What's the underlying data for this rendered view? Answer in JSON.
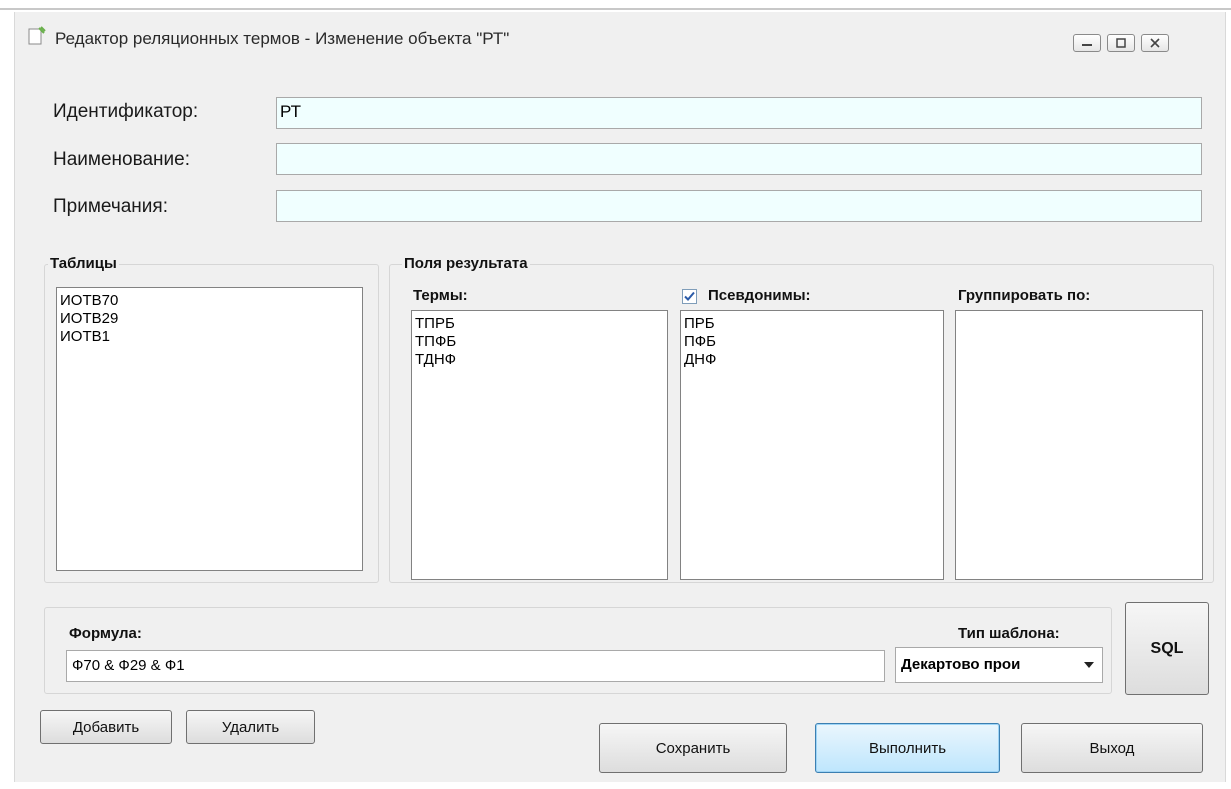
{
  "window": {
    "title": "Редактор реляционных термов  -  Изменение объекта \"РТ\""
  },
  "fields": {
    "identifier_label": "Идентификатор:",
    "identifier_value": "РТ",
    "name_label": "Наименование:",
    "name_value": "",
    "notes_label": "Примечания:",
    "notes_value": ""
  },
  "tables_group": {
    "label": "Таблицы",
    "items": [
      "ИОТВ70",
      "ИОТВ29",
      "ИОТВ1"
    ]
  },
  "result_fields_group": {
    "label": "Поля результата",
    "terms_label": "Термы:",
    "terms": [
      "ТПРБ",
      "ТПФБ",
      "ТДНФ"
    ],
    "aliases_label": "Псевдонимы:",
    "aliases_checked": true,
    "aliases": [
      "ПРБ",
      "ПФБ",
      "ДНФ"
    ],
    "group_by_label": "Группировать по:",
    "group_by": []
  },
  "formula": {
    "label": "Формула:",
    "value": "Ф70 & Ф29 & Ф1",
    "template_type_label": "Тип шаблона:",
    "template_type_value": "Декартово прои"
  },
  "buttons": {
    "sql": "SQL",
    "add": "Добавить",
    "delete": "Удалить",
    "save": "Сохранить",
    "execute": "Выполнить",
    "exit": "Выход"
  },
  "colors": {
    "window_bg": "#f0f0f0",
    "input_bg": "#f0ffff",
    "focus_button": "#3c7fb1"
  }
}
